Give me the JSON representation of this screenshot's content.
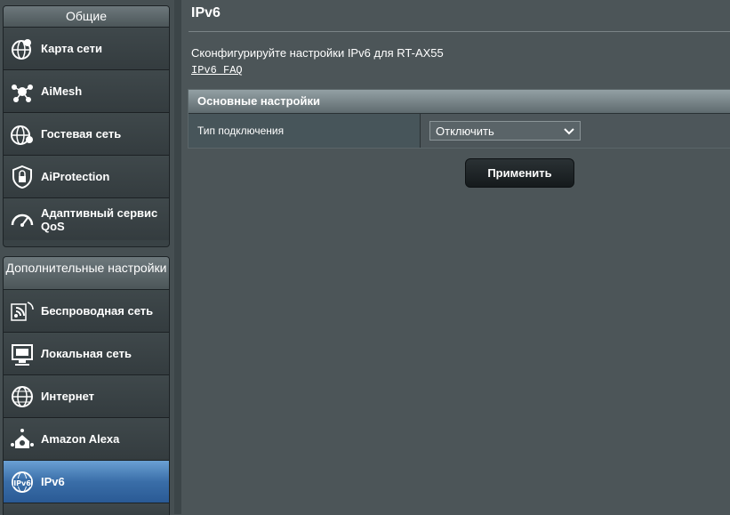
{
  "sidebar": {
    "general_header": "Общие",
    "general_items": [
      {
        "label": "Карта сети",
        "icon": "network-map-icon"
      },
      {
        "label": "AiMesh",
        "icon": "aimesh-icon"
      },
      {
        "label": "Гостевая сеть",
        "icon": "guest-network-icon"
      },
      {
        "label": "AiProtection",
        "icon": "lock-icon"
      },
      {
        "label": "Адаптивный сервис QoS",
        "icon": "speedometer-icon"
      }
    ],
    "advanced_header": "Дополнительные настройки",
    "advanced_items": [
      {
        "label": "Беспроводная сеть",
        "icon": "wifi-icon"
      },
      {
        "label": "Локальная сеть",
        "icon": "lan-icon"
      },
      {
        "label": "Интернет",
        "icon": "globe-icon"
      },
      {
        "label": "Amazon Alexa",
        "icon": "alexa-icon"
      },
      {
        "label": "IPv6",
        "icon": "ipv6-globe-icon",
        "active": true
      }
    ]
  },
  "main": {
    "title": "IPv6",
    "description": "Сконфигурируйте настройки IPv6 для RT-AX55",
    "faq_link": "IPv6 FAQ",
    "section_header": "Основные настройки",
    "connection_type_label": "Тип подключения",
    "connection_type_value": "Отключить",
    "apply_button": "Применить"
  },
  "colors": {
    "background": "#4c5558",
    "active_item": "#3a6ea8"
  }
}
